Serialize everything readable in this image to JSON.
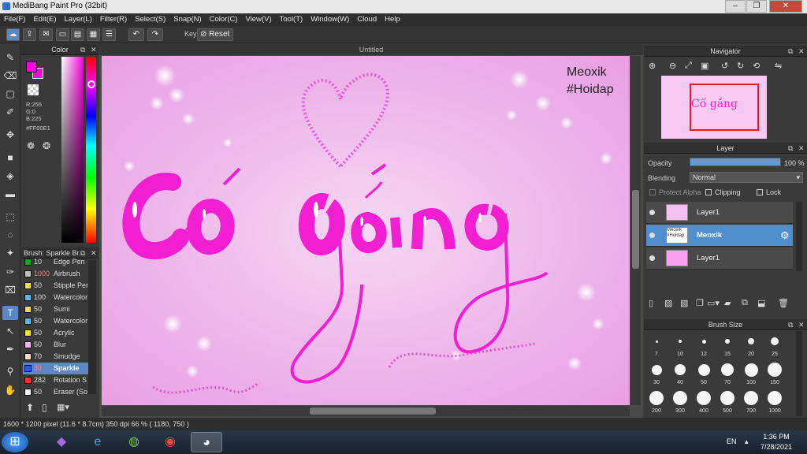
{
  "window": {
    "title": "MediBang Paint Pro (32bit)",
    "minimize": "–",
    "restore": "❐",
    "close": "✕"
  },
  "menu": [
    "File(F)",
    "Edit(E)",
    "Layer(L)",
    "Filter(R)",
    "Select(S)",
    "Snap(N)",
    "Color(C)",
    "View(V)",
    "Tool(T)",
    "Window(W)",
    "Cloud",
    "Help"
  ],
  "toolbar": {
    "key_label": "Key",
    "reset_label": "Reset"
  },
  "color_panel": {
    "title": "Color",
    "r": "R:255",
    "g": "G:0",
    "b": "B:225",
    "hex": "#FF00E1",
    "primary": "#ff00e1"
  },
  "brush_panel": {
    "title": "Brush: Sparkle Br...",
    "items": [
      {
        "size": "10",
        "name": "Edge Pen",
        "swatch": "#1e9e2a",
        "selected": false
      },
      {
        "size": "1000",
        "name": "Airbrush",
        "swatch": "#bfbfbf",
        "selected": false
      },
      {
        "size": "50",
        "name": "Stipple Pen",
        "swatch": "#f2e33a",
        "selected": false
      },
      {
        "size": "100",
        "name": "Watercolor",
        "swatch": "#62b7e6",
        "selected": false
      },
      {
        "size": "50",
        "name": "Sumi",
        "swatch": "#f2e33a",
        "selected": false
      },
      {
        "size": "50",
        "name": "Watercolor",
        "swatch": "#62b7e6",
        "selected": false
      },
      {
        "size": "50",
        "name": "Acrylic",
        "swatch": "#f2e33a",
        "selected": false
      },
      {
        "size": "50",
        "name": "Blur",
        "swatch": "#f1b6ee",
        "selected": false
      },
      {
        "size": "70",
        "name": "Smudge",
        "swatch": "#f6dcc9",
        "selected": false
      },
      {
        "size": "30",
        "name": "Sparkle",
        "swatch": "#3d52d6",
        "selected": true
      },
      {
        "size": "282",
        "name": "Rotation S",
        "swatch": "#e53535",
        "selected": false
      },
      {
        "size": "50",
        "name": "Eraser (So",
        "swatch": "#f5f5f5",
        "selected": false
      }
    ]
  },
  "canvas": {
    "tab_title": "Untitled",
    "watermark_line1": "Meoxik",
    "watermark_line2": "#Hoidap",
    "artwork_text_1": "Cố",
    "artwork_text_2": "gắng"
  },
  "navigator": {
    "title": "Navigator"
  },
  "layer_panel": {
    "title": "Layer",
    "opacity_label": "Opacity",
    "opacity_value": "100 %",
    "opacity_percent": 100,
    "blending_label": "Blending",
    "blending_value": "Normal",
    "protect_alpha": "Protect Alpha",
    "clipping": "Clipping",
    "lock": "Lock",
    "layers": [
      {
        "name": "Layer1",
        "thumb": "",
        "selected": false
      },
      {
        "name": "Meoxik",
        "thumb": "Meoxik #Hoidap",
        "selected": true
      },
      {
        "name": "Layer1",
        "thumb": "",
        "selected": false
      }
    ]
  },
  "brush_size": {
    "title": "Brush Size",
    "sizes": [
      "7",
      "10",
      "12",
      "15",
      "20",
      "25",
      "30",
      "40",
      "50",
      "70",
      "100",
      "150",
      "200",
      "300",
      "400",
      "500",
      "700",
      "1000"
    ]
  },
  "status": {
    "text": "1600 * 1200 pixel   (11.6 * 8.7cm)   350 dpi   66 %   ( 1180, 750 )"
  },
  "taskbar": {
    "lang": "EN",
    "time": "1:36 PM",
    "date": "7/28/2021"
  },
  "colors": {
    "accent": "#5a87c5",
    "artwork": "#f21fd2",
    "canvas_bg": "#f0c0ec"
  }
}
